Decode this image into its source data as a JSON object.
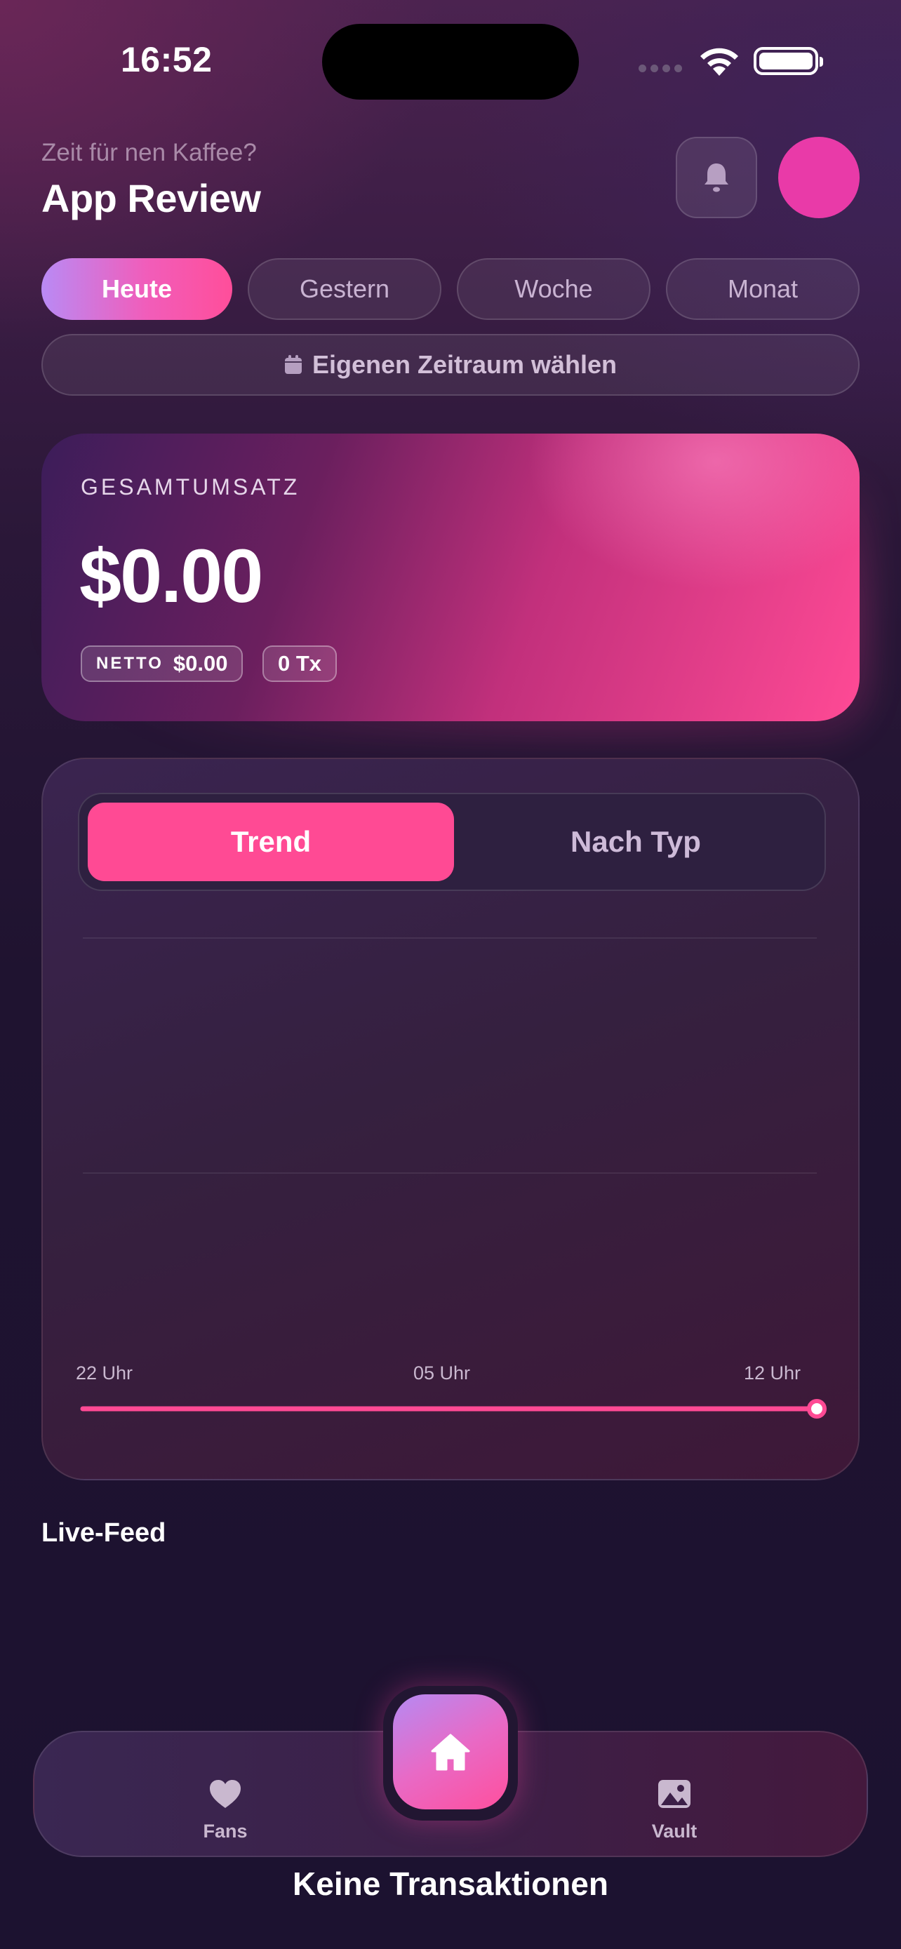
{
  "status_bar": {
    "time": "16:52"
  },
  "header": {
    "greeting": "Zeit für nen Kaffee?",
    "title": "App Review"
  },
  "period_tabs": [
    {
      "label": "Heute",
      "active": true
    },
    {
      "label": "Gestern",
      "active": false
    },
    {
      "label": "Woche",
      "active": false
    },
    {
      "label": "Monat",
      "active": false
    }
  ],
  "custom_range_label": "Eigenen Zeitraum wählen",
  "revenue": {
    "label": "GESAMTUMSATZ",
    "amount": "$0.00",
    "net_label": "NETTO",
    "net_value": "$0.00",
    "tx_count": "0 Tx"
  },
  "chart_toggle": {
    "active": "Trend",
    "inactive": "Nach Typ"
  },
  "chart_data": {
    "type": "line",
    "x": [
      "22 Uhr",
      "05 Uhr",
      "12 Uhr"
    ],
    "series": [
      {
        "values": [
          0,
          0,
          0
        ]
      }
    ],
    "grid": true
  },
  "live_feed_title": "Live-Feed",
  "bottom_nav": {
    "fans": "Fans",
    "vault": "Vault"
  },
  "empty_state": "Keine Transaktionen",
  "colors": {
    "accent": "#ff4a94",
    "avatar": "#e93aa8",
    "background": "#1f1330"
  }
}
